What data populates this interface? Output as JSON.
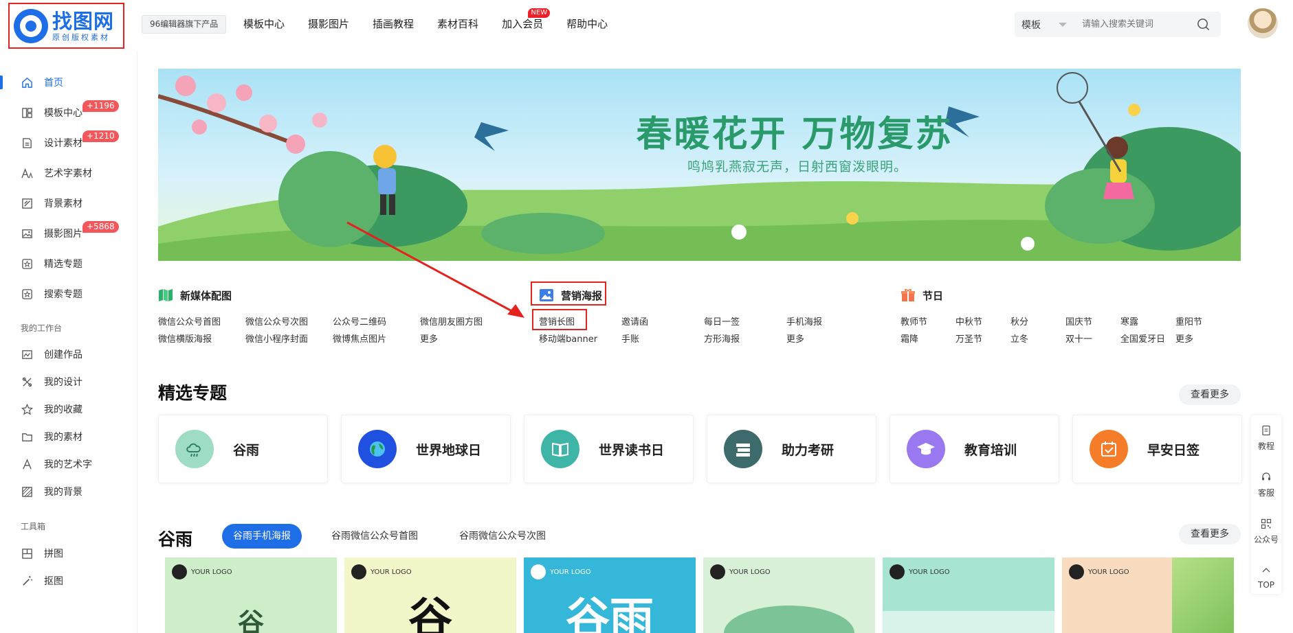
{
  "header": {
    "logo_name": "找图网",
    "logo_slogan": "原创版权素材",
    "badge": "96编辑器旗下产品",
    "nav": [
      "模板中心",
      "摄影图片",
      "插画教程",
      "素材百科",
      "加入会员",
      "帮助中心"
    ],
    "new_tag": "NEW",
    "search_select": "模板",
    "search_placeholder": "请输入搜索关键词"
  },
  "sidebar": {
    "items": [
      {
        "label": "首页",
        "icon": "home-icon"
      },
      {
        "label": "模板中心",
        "icon": "template-icon",
        "badge": "+1196"
      },
      {
        "label": "设计素材",
        "icon": "design-material-icon",
        "badge": "+1210"
      },
      {
        "label": "艺术字素材",
        "icon": "art-text-icon"
      },
      {
        "label": "背景素材",
        "icon": "background-icon"
      },
      {
        "label": "摄影图片",
        "icon": "photo-icon",
        "badge": "+5868"
      },
      {
        "label": "精选专题",
        "icon": "featured-topic-icon"
      },
      {
        "label": "搜索专题",
        "icon": "search-topic-icon"
      }
    ],
    "group_workspace": "我的工作台",
    "workspace": [
      {
        "label": "创建作品",
        "icon": "create-work-icon"
      },
      {
        "label": "我的设计",
        "icon": "my-design-icon"
      },
      {
        "label": "我的收藏",
        "icon": "star-icon"
      },
      {
        "label": "我的素材",
        "icon": "folder-icon"
      },
      {
        "label": "我的艺术字",
        "icon": "letter-a-icon"
      },
      {
        "label": "我的背景",
        "icon": "hatch-icon"
      }
    ],
    "group_tools": "工具箱",
    "tools": [
      {
        "label": "拼图",
        "icon": "collage-icon"
      },
      {
        "label": "抠图",
        "icon": "magic-wand-icon"
      }
    ]
  },
  "banner": {
    "headline": "春暖花开 万物复苏",
    "subline": "鸣鸠乳燕寂无声，日射西窗泼眼明。"
  },
  "categories": {
    "new_media": {
      "title": "新媒体配图",
      "links": [
        "微信公众号首图",
        "微信公众号次图",
        "公众号二维码",
        "微信朋友圈方图",
        "微信横版海报",
        "微信小程序封面",
        "微博焦点图片",
        "更多"
      ]
    },
    "marketing": {
      "title": "营销海报",
      "links": [
        "营销长图",
        "邀请函",
        "每日一签",
        "手机海报",
        "移动端banner",
        "手账",
        "方形海报",
        "更多"
      ]
    },
    "festival": {
      "title": "节日",
      "links": [
        "教师节",
        "中秋节",
        "秋分",
        "国庆节",
        "寒露",
        "重阳节",
        "霜降",
        "万圣节",
        "立冬",
        "双十一",
        "全国爱牙日",
        "更多"
      ]
    }
  },
  "featured": {
    "title": "精选专题",
    "more": "查看更多",
    "topics": [
      {
        "name": "谷雨",
        "color": "#9edcc4"
      },
      {
        "name": "世界地球日",
        "color": "#2050e0"
      },
      {
        "name": "世界读书日",
        "color": "#3fb5a8"
      },
      {
        "name": "助力考研",
        "color": "#3d6a6a"
      },
      {
        "name": "教育培训",
        "color": "#9a78f0"
      },
      {
        "name": "早安日签",
        "color": "#f57d2a"
      }
    ]
  },
  "guyu": {
    "title": "谷雨",
    "tabs": [
      "谷雨手机海报",
      "谷雨微信公众号首图",
      "谷雨微信公众号次图"
    ],
    "more": "查看更多",
    "posters": [
      {
        "logo": "YOUR LOGO",
        "char": "谷",
        "bg": "#cdeec8"
      },
      {
        "logo": "YOUR LOGO",
        "char": "谷",
        "bg": "#f2f6c9"
      },
      {
        "logo": "YOUR LOGO",
        "char": "谷雨",
        "bg": "#35b7d9"
      },
      {
        "logo": "YOUR LOGO",
        "char": "",
        "bg": "#d9f0d8"
      },
      {
        "logo": "YOUR LOGO",
        "char": "",
        "bg": "#a7e4d1"
      },
      {
        "logo": "YOUR LOGO",
        "char": "",
        "bg": "#f9dcc0"
      }
    ]
  },
  "rail": {
    "items": [
      "教程",
      "客服",
      "公众号",
      "TOP"
    ]
  }
}
